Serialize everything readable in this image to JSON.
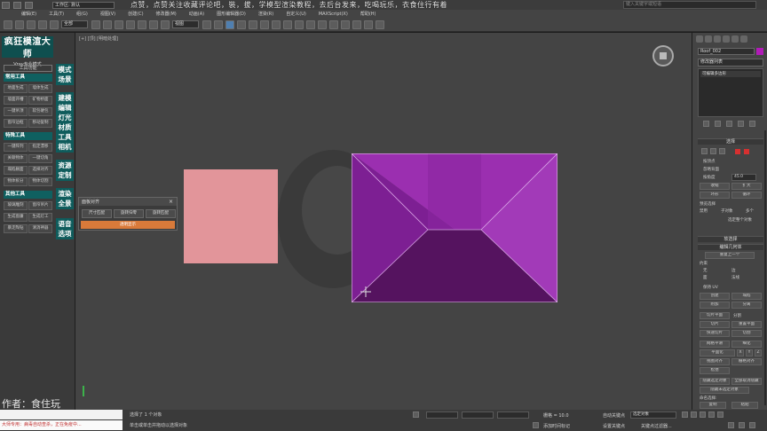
{
  "titlebar": {
    "workspace": "工作区: 默认",
    "marquee": "点赞，点赞关注收藏评论吧，裝，拔，学模型渲染教程，去后台发来，吃喝玩乐，衣食住行有着",
    "search_placeholder": "键入关键字或短语"
  },
  "menubar": {
    "items": [
      "编辑(E)",
      "工具(T)",
      "组(G)",
      "视图(V)",
      "创建(C)",
      "修改器(M)",
      "动画(A)",
      "图形编辑器(D)",
      "渲染(R)",
      "自定义(U)",
      "MAXScript(X)",
      "帮助(H)"
    ]
  },
  "toolbar": {
    "filter_select": "全部",
    "view_select": "视图"
  },
  "left_panel": {
    "brand_title": "疯狂模渲大师",
    "brand_subtitle": "Vray专业模式",
    "tools_header": "工具功能",
    "common_title": "常用工具",
    "common_buttons": [
      "地面生成",
      "墙体生成",
      "墙面开槽",
      "矿物桥面",
      "一键吊顶",
      "软包硬包",
      "窗帘边框",
      "移动复制"
    ],
    "special_title": "特殊工具",
    "special_buttons": [
      "一键阵列",
      "指定漂移",
      "关联物体",
      "一键切角",
      "塌陷删面",
      "选择对齐",
      "物体拆分",
      "物体切割"
    ],
    "other_title": "其他工具",
    "other_buttons": [
      "玻璃雕刻",
      "窗帘吊片",
      "生成窗廉",
      "生成灯工",
      "暴走陶钻",
      "清消神器"
    ],
    "vertical_tabs": [
      [
        "模式",
        "场景"
      ],
      [
        "建模",
        "编辑",
        "灯光",
        "材质",
        "工具",
        "相机"
      ],
      [
        "资源",
        "定制"
      ],
      [
        "渲染",
        "全景"
      ],
      [
        "语音",
        "选项"
      ]
    ],
    "author": "作者：食住玩"
  },
  "viewport": {
    "label": "[+] [顶] [明暗处理]",
    "colors": {
      "pink_box": "#e2959a",
      "roof_top": "#9b2fb0",
      "roof_left": "#7d1f93",
      "roof_right": "#a23ab8",
      "roof_bottom": "#55135f",
      "roof_center": "#8a27a0"
    }
  },
  "dialog": {
    "title": "面板对齐",
    "buttons": [
      "尺寸匹配",
      "旋转归零",
      "旋转匹配"
    ],
    "orange_button": "透明显示"
  },
  "right_panel": {
    "object_name": "Roof_002",
    "modifier_list": "修改器列表",
    "stack_item": "可编辑多边形",
    "roll_select": "选择",
    "select_by_vertex": "按顶点",
    "ignore_backface": "忽略背面",
    "angle_label": "按角度",
    "angle_value": "45.0",
    "shrink": "收缩",
    "grow": "扩大",
    "ring": "环形",
    "loop": "循环",
    "preview_label": "预览选择",
    "preview_options": [
      "禁用",
      "子对象",
      "多个"
    ],
    "selected_info": "选定整个对象",
    "roll_soft": "软选择",
    "roll_edit_geo": "编辑几何体",
    "repeat_last": "重复上一个",
    "constraints": "约束",
    "constraint_options": [
      "无",
      "边",
      "面",
      "法线"
    ],
    "preserve_uv": "保持 UV",
    "create": "创建",
    "collapse": "塌陷",
    "attach": "附加",
    "detach": "分离",
    "slice_plane": "切片平面",
    "split": "分割",
    "slice": "切片",
    "reset_plane": "重置平面",
    "quickslice": "快速切片",
    "cut": "切割",
    "meshsmooth": "网格平滑",
    "tessellate": "细化",
    "planarize": "平面化",
    "xyz": [
      "X",
      "Y",
      "Z"
    ],
    "view_align": "视图对齐",
    "grid_align": "栅格对齐",
    "relax": "松弛",
    "hide_selected": "隐藏选定对象",
    "unhide_all": "全部取消隐藏",
    "hide_unselected": "隐藏未选定对象",
    "named_selections": "命名选择:",
    "copy": "复制",
    "paste": "粘贴"
  },
  "statusbar": {
    "maxscript_msg": "大师专用：病毒自动查杀，正在免疫中...",
    "selected": "选择了 1 个对象",
    "hint": "单击或单击并拖动以选择对象",
    "grid": "栅格 = 10.0",
    "autokey": "自动关键点",
    "set_key": "设置关键点",
    "selection_set": "选定对象",
    "key_filters": "关键点过滤器...",
    "add_time_tag": "添加时间标记"
  }
}
